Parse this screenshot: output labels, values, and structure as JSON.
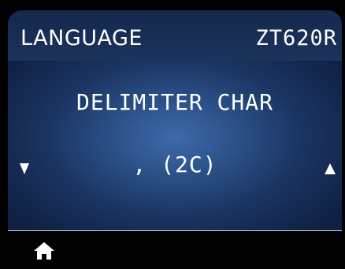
{
  "header": {
    "left_label": "LANGUAGE",
    "right_label": "ZT620R"
  },
  "setting": {
    "name": "DELIMITER CHAR",
    "value": ", (2C)"
  },
  "controls": {
    "prev_icon": "triangle-down-icon",
    "next_icon": "triangle-up-icon",
    "home_icon": "home-icon"
  },
  "colors": {
    "background": "#000000",
    "panel_dark": "#0f2043",
    "panel_light": "#3d6aa9",
    "text": "#ffffff"
  }
}
